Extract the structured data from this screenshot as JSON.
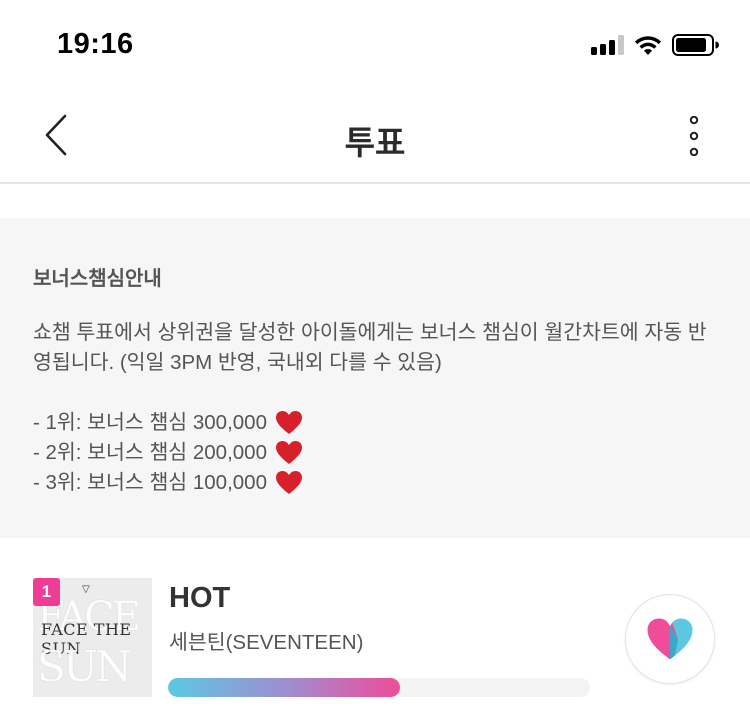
{
  "status_bar": {
    "time": "19:16",
    "signal_icon": "cellular-signal-icon",
    "wifi_icon": "wifi-icon",
    "battery_icon": "battery-icon"
  },
  "header": {
    "title": "투표",
    "back_icon": "chevron-left-icon",
    "more_icon": "more-vertical-icon"
  },
  "info": {
    "title": "보너스챔심안내",
    "body": "쇼챔 투표에서 상위권을 달성한 아이돌에게는 보너스 챔심이 월간차트에 자동 반영됩니다. (익일 3PM 반영, 국내외 다를 수 있음)",
    "bonus_lines": [
      {
        "text": "- 1위: 보너스 챔심 300,000"
      },
      {
        "text": "- 2위: 보너스 챔심 200,000"
      },
      {
        "text": "- 3위: 보너스 챔심 100,000"
      }
    ],
    "heart_emoji_icon": "red-heart-icon",
    "heart_color": "#d8202a"
  },
  "ranking": [
    {
      "rank": "1",
      "title": "HOT",
      "artist": "세븐틴(SEVENTEEN)",
      "progress_fraction": 0.55,
      "album_art_text": "FACE THE SUN",
      "vote_icon": "vote-heart-icon"
    }
  ],
  "colors": {
    "accent_pink": "#ee3d95",
    "accent_cyan": "#5cc8e0",
    "info_bg": "#f6f6f6"
  }
}
